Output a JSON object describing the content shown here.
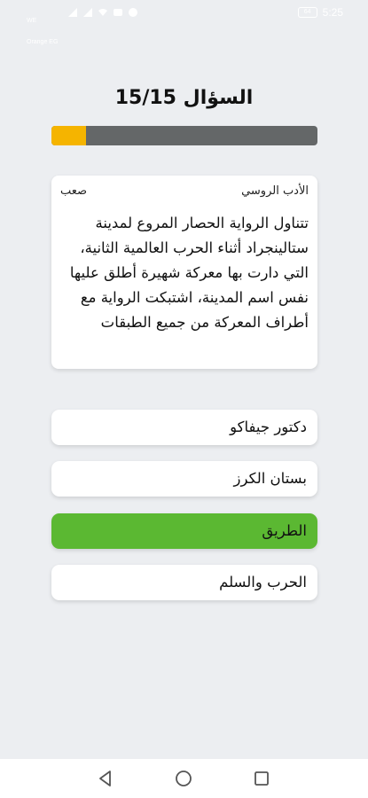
{
  "status_bar": {
    "carrier_line1": "WE",
    "carrier_line2": "Orange EG",
    "battery": "64",
    "time": "5:25",
    "icons": [
      "signal-icon",
      "signal-icon",
      "wifi-icon",
      "messenger-icon",
      "facebook-icon"
    ]
  },
  "quiz": {
    "title": "السؤال 15/15",
    "progress": 0.13,
    "colors": {
      "progress_fill": "#f5b400",
      "progress_track": "#646768",
      "correct": "#5bb832"
    }
  },
  "question": {
    "category": "الأدب الروسي",
    "difficulty": "صعب",
    "text": "تتناول الرواية الحصار المروع لمدينة ستالينجراد أثناء الحرب العالمية الثانية، التي دارت بها معركة شهيرة أطلق عليها نفس اسم المدينة، اشتبكت الرواية مع أطراف المعركة من جميع الطبقات"
  },
  "answers": [
    {
      "label": "دكتور جيفاكو",
      "state": "default"
    },
    {
      "label": "بستان الكرز",
      "state": "default"
    },
    {
      "label": "الطريق",
      "state": "correct"
    },
    {
      "label": "الحرب والسلم",
      "state": "default"
    }
  ],
  "nav": [
    "back-icon",
    "home-icon",
    "recents-icon"
  ]
}
